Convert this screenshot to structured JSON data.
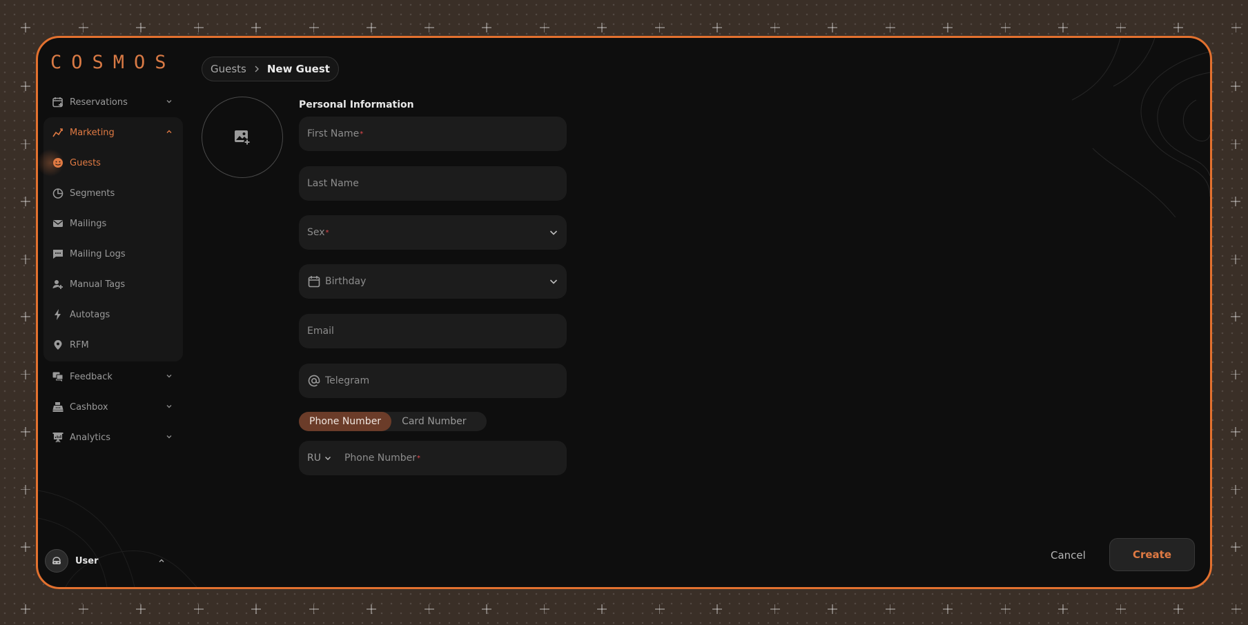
{
  "app": {
    "logo": "COSMOS"
  },
  "sidebar": {
    "items": [
      {
        "label": "Reservations",
        "icon": "calendar-plus-icon"
      },
      {
        "label": "Marketing",
        "icon": "trend-chart-icon"
      },
      {
        "label": "Guests",
        "icon": "smiley-icon"
      },
      {
        "label": "Segments",
        "icon": "pie-chart-icon"
      },
      {
        "label": "Mailings",
        "icon": "mail-icon"
      },
      {
        "label": "Mailing Logs",
        "icon": "chat-dots-icon"
      },
      {
        "label": "Manual Tags",
        "icon": "user-tag-icon"
      },
      {
        "label": "Autotags",
        "icon": "lightning-icon"
      },
      {
        "label": "RFM",
        "icon": "map-pin-icon"
      },
      {
        "label": "Feedback",
        "icon": "feedback-icon"
      },
      {
        "label": "Cashbox",
        "icon": "cash-register-icon"
      },
      {
        "label": "Analytics",
        "icon": "analytics-board-icon"
      }
    ],
    "user": {
      "name": "User"
    }
  },
  "breadcrumb": {
    "parent": "Guests",
    "current": "New Guest"
  },
  "form": {
    "section_title": "Personal Information",
    "first_name": "First Name",
    "last_name": "Last Name",
    "sex": "Sex",
    "birthday": "Birthday",
    "email": "Email",
    "telegram": "Telegram",
    "required_mark": "*",
    "toggle": {
      "phone": "Phone Number",
      "card": "Card Number"
    },
    "phone": {
      "country": "RU",
      "placeholder": "Phone Number"
    }
  },
  "actions": {
    "cancel": "Cancel",
    "create": "Create"
  },
  "colors": {
    "accent": "#e3712f",
    "background": "#0e0e0e",
    "field": "#1c1c1c"
  }
}
